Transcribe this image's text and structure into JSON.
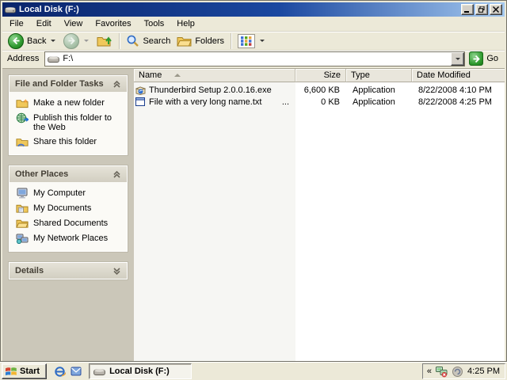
{
  "window": {
    "title": "Local Disk (F:)"
  },
  "menu": {
    "items": [
      "File",
      "Edit",
      "View",
      "Favorites",
      "Tools",
      "Help"
    ]
  },
  "toolbar": {
    "back_label": "Back",
    "search_label": "Search",
    "folders_label": "Folders"
  },
  "address_bar": {
    "label": "Address",
    "value": "F:\\",
    "go_label": "Go"
  },
  "sidebar": {
    "panels": [
      {
        "title": "File and Folder Tasks",
        "items": [
          {
            "label": "Make a new folder",
            "icon": "new-folder-icon"
          },
          {
            "label": "Publish this folder to the Web",
            "icon": "web-publish-icon"
          },
          {
            "label": "Share this folder",
            "icon": "share-folder-icon"
          }
        ]
      },
      {
        "title": "Other Places",
        "items": [
          {
            "label": "My Computer",
            "icon": "my-computer-icon"
          },
          {
            "label": "My Documents",
            "icon": "my-documents-icon"
          },
          {
            "label": "Shared Documents",
            "icon": "shared-documents-icon"
          },
          {
            "label": "My Network Places",
            "icon": "network-places-icon"
          }
        ]
      },
      {
        "title": "Details",
        "items": []
      }
    ]
  },
  "file_list": {
    "columns": [
      "Name",
      "Size",
      "Type",
      "Date Modified"
    ],
    "sort_column": "Name",
    "rows": [
      {
        "name": "Thunderbird Setup 2.0.0.16.exe",
        "size": "6,600 KB",
        "type": "Application",
        "date": "8/22/2008 4:10 PM",
        "icon": "thunderbird-setup-icon",
        "ellipsis": ""
      },
      {
        "name": "File with a very long name.txt",
        "size": "0 KB",
        "type": "Application",
        "date": "8/22/2008 4:25 PM",
        "icon": "generic-file-icon",
        "ellipsis": "..."
      }
    ]
  },
  "taskbar": {
    "start_label": "Start",
    "task_button_label": "Local Disk (F:)",
    "tray_chevron": "«",
    "clock": "4:25 PM"
  },
  "colors": {
    "titlebar_left": "#0a246a",
    "titlebar_right": "#a6caf0",
    "chrome_face": "#ece9d8",
    "sidebar_bg": "#cbc7b9",
    "panel_body": "#fbfaf6",
    "go_green": "#2f9a2f",
    "sorted_column_shade": "#f6f6f3"
  }
}
